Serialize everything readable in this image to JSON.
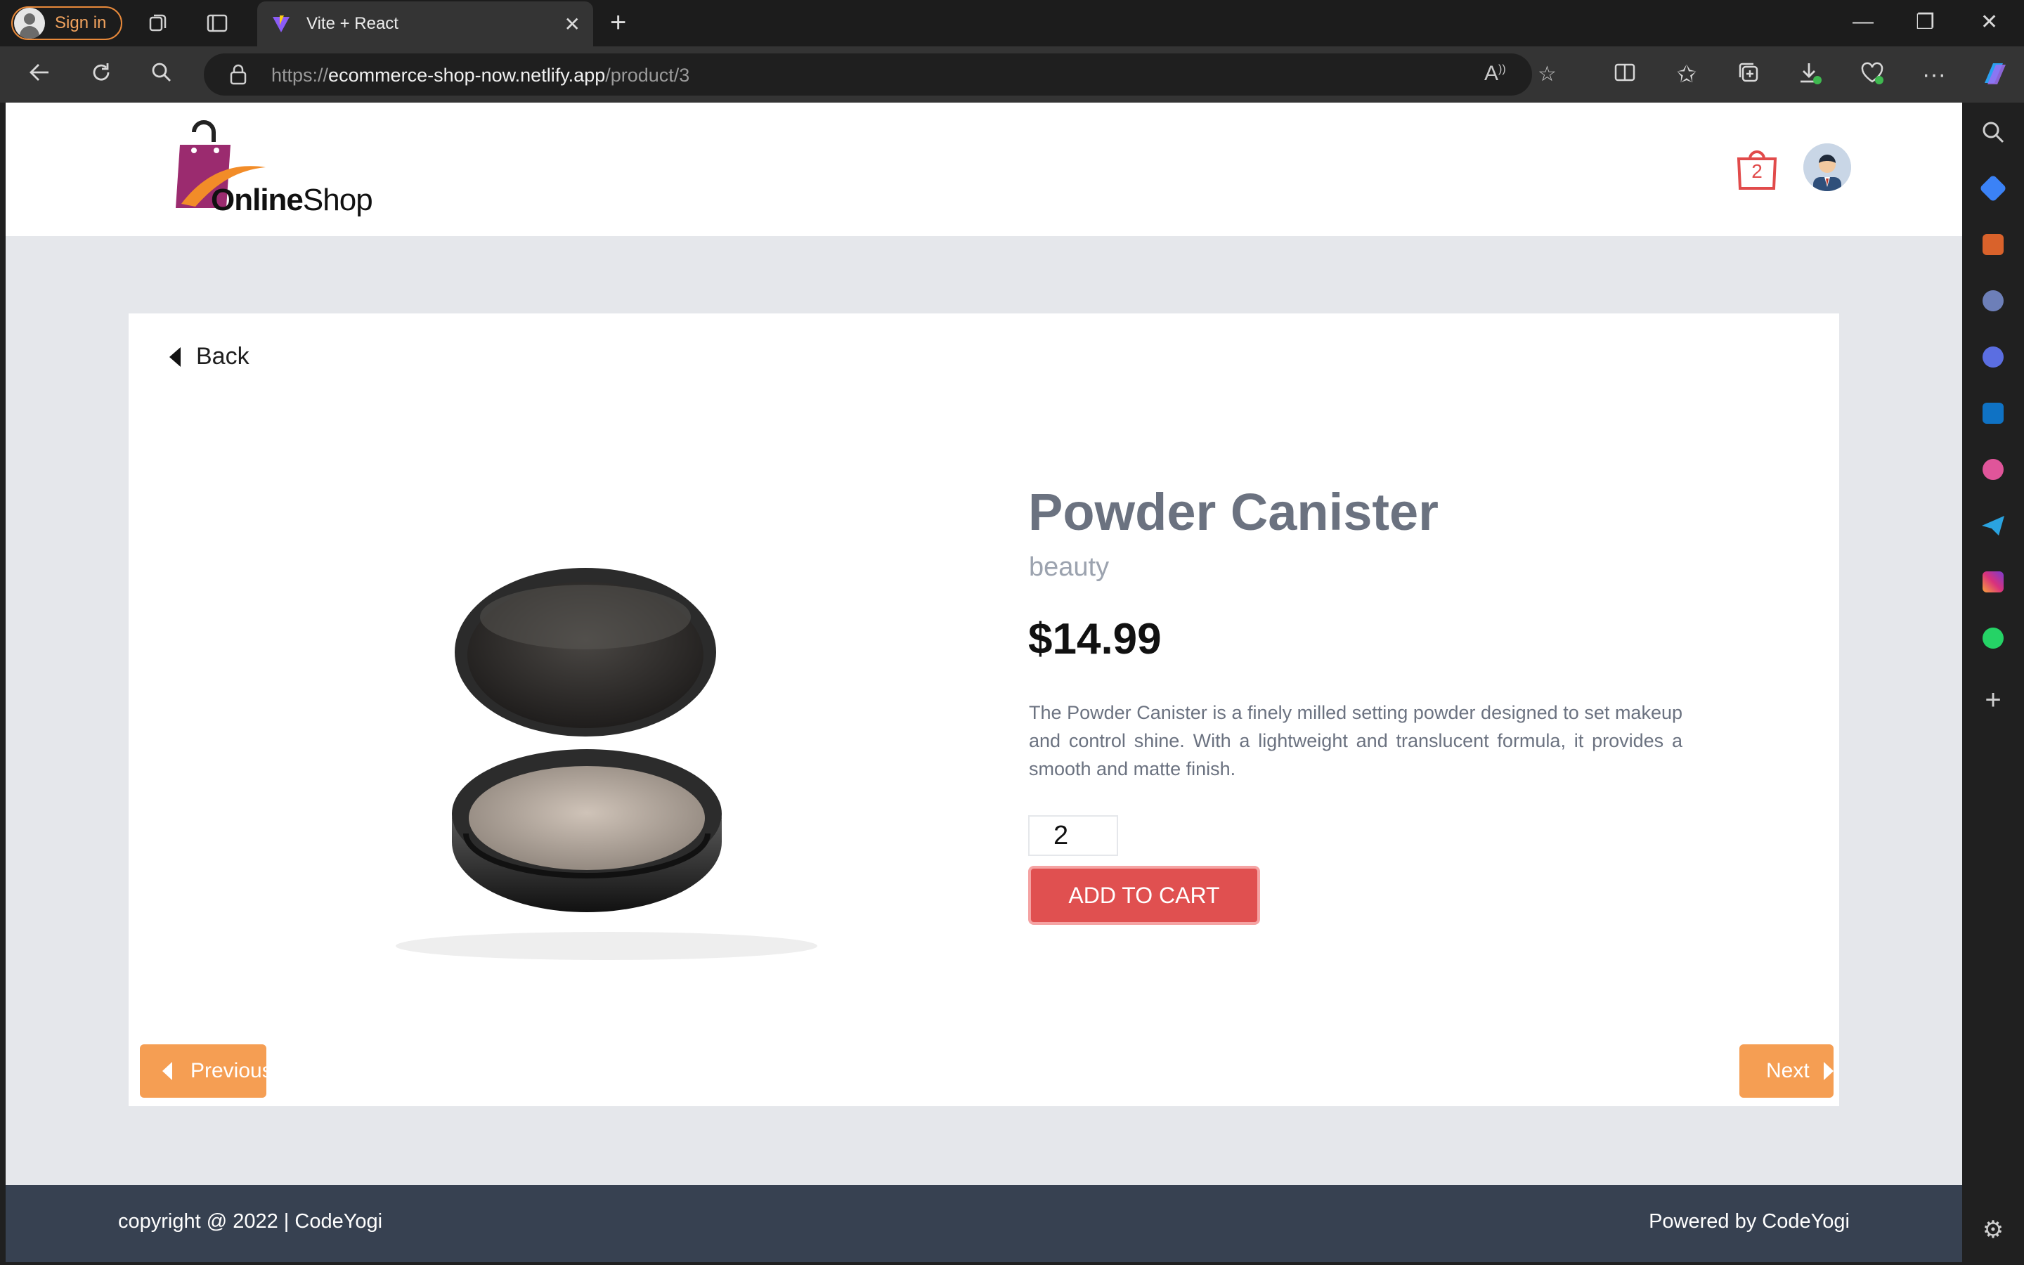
{
  "browser": {
    "signin_label": "Sign in",
    "tab_title": "Vite + React",
    "url_prefix": "https://",
    "url_host": "ecommerce-shop-now.netlify.app",
    "url_path": "/product/3"
  },
  "header": {
    "logo_word_bold": "Online",
    "logo_word_regular": "Shop",
    "cart_count": "2"
  },
  "product": {
    "back_label": "Back",
    "title": "Powder Canister",
    "category": "beauty",
    "price": "$14.99",
    "description": "The Powder Canister is a finely milled setting powder designed to set makeup and control shine. With a lightweight and translucent formula, it provides a smooth and matte finish.",
    "quantity": "2",
    "add_to_cart_label": "ADD TO CART",
    "previous_label": "Previous",
    "next_label": "Next"
  },
  "footer": {
    "copyright": "copyright @ 2022 | CodeYogi",
    "powered_by": "Powered by CodeYogi"
  },
  "colors": {
    "accent_orange": "#f59e53",
    "add_to_cart_red": "#e05050",
    "footer_bg": "#374151"
  },
  "icons": [
    "user-icon",
    "workspaces-icon",
    "tab-actions-icon",
    "vite-favicon",
    "close-icon",
    "plus-icon",
    "minimize-icon",
    "restore-icon",
    "window-close-icon",
    "back-arrow-icon",
    "refresh-icon",
    "search-icon",
    "lock-icon",
    "read-aloud-icon",
    "favorite-star-icon",
    "split-screen-icon",
    "favorites-icon",
    "collections-icon",
    "downloads-icon",
    "health-icon",
    "more-icon",
    "copilot-icon",
    "shopping-bag-icon",
    "avatar-icon",
    "caret-left-icon",
    "caret-right-icon",
    "settings-icon"
  ]
}
